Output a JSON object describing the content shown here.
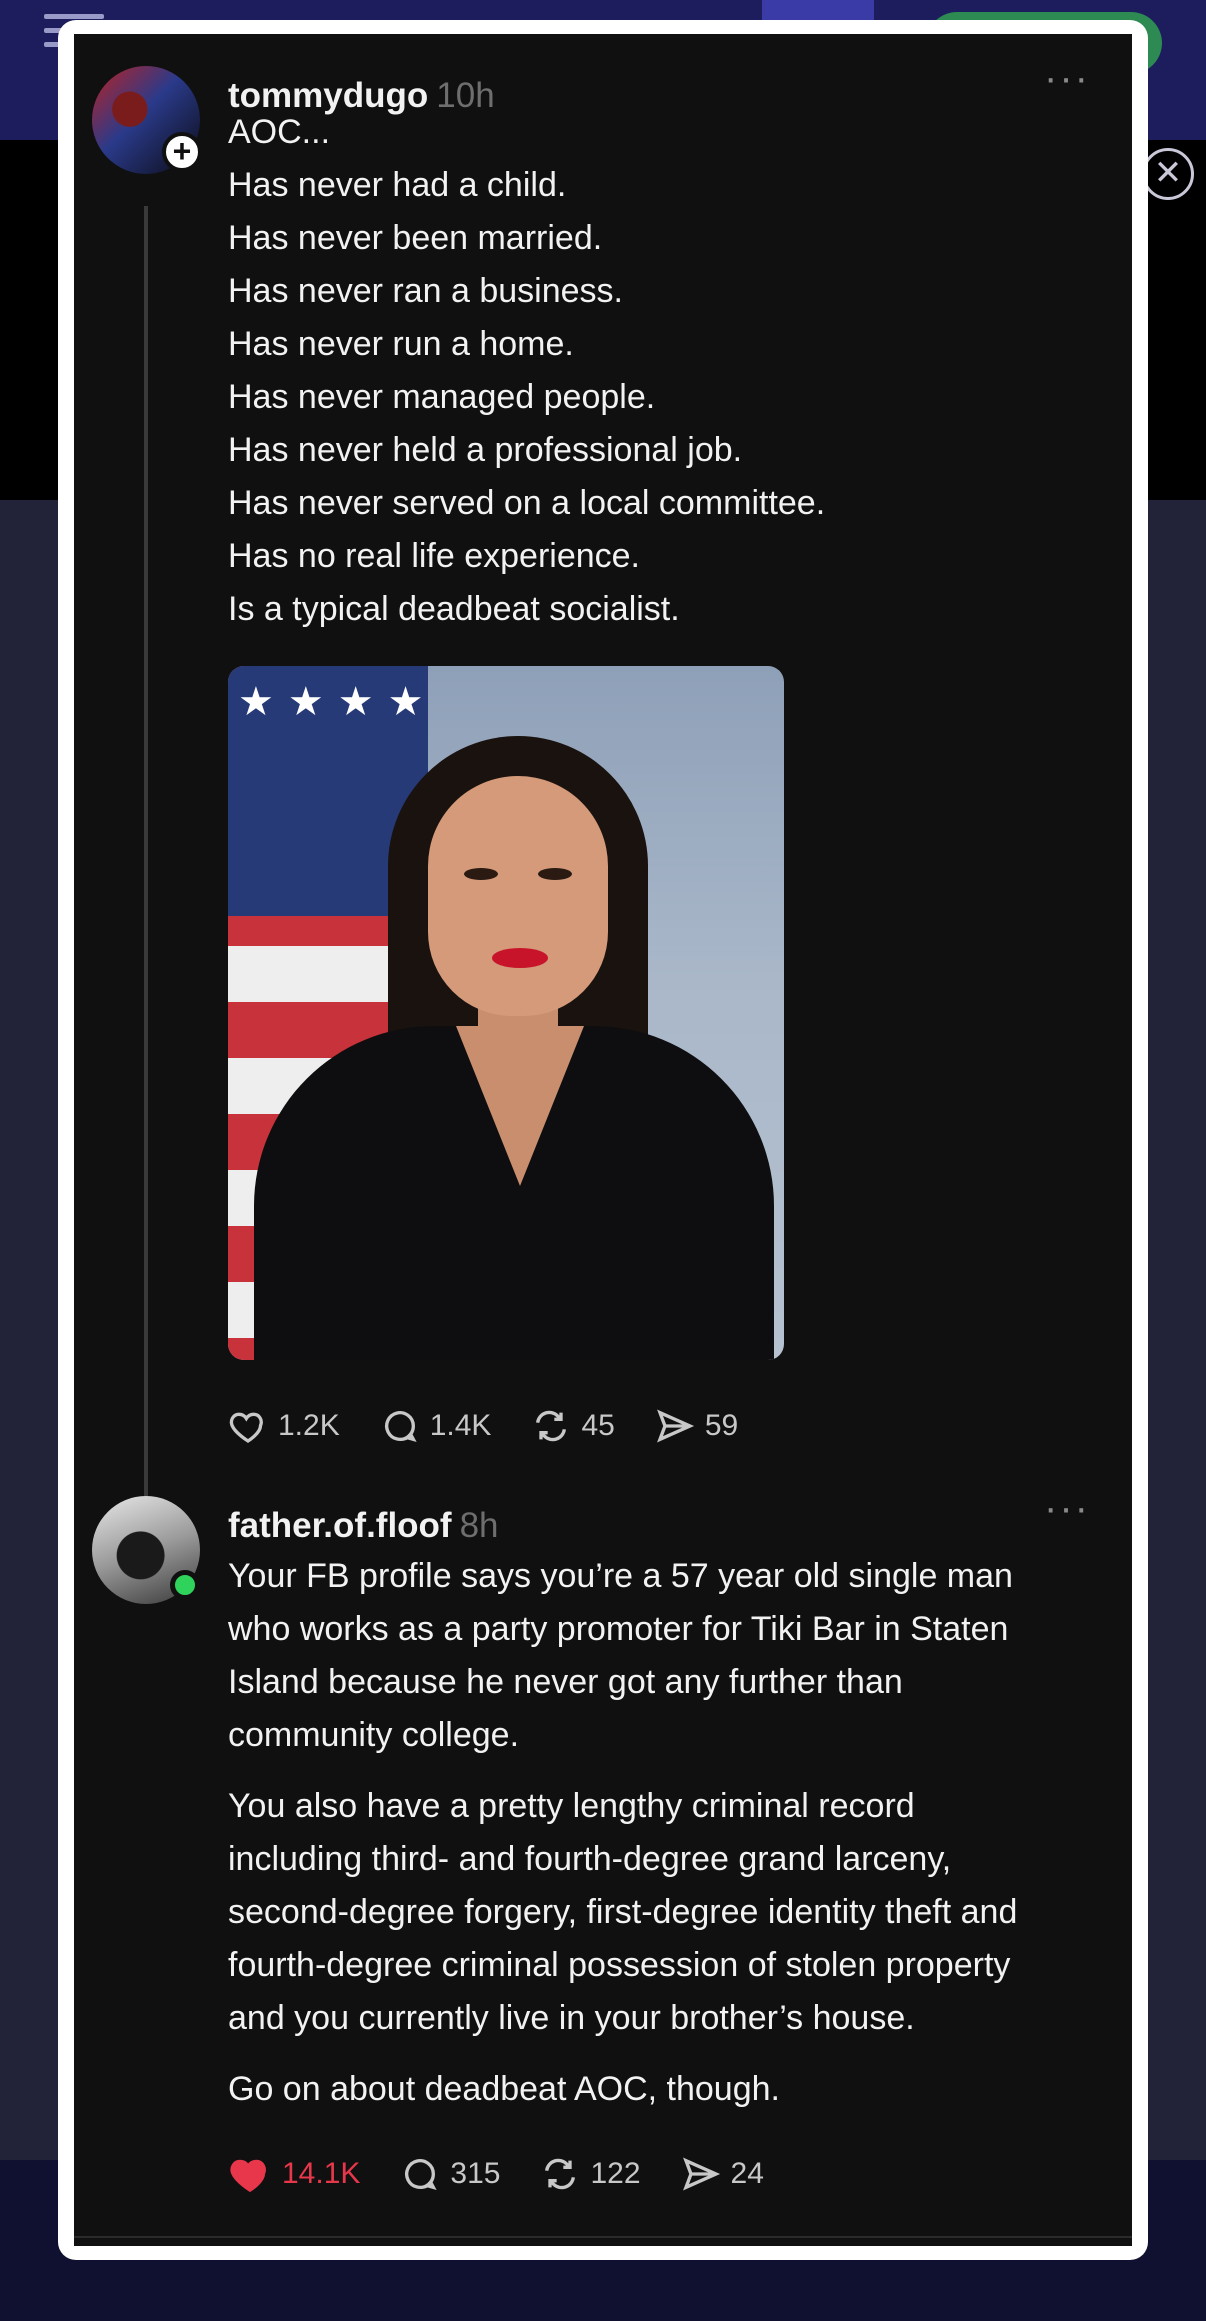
{
  "thread": {
    "original_post": {
      "username": "tommydugo",
      "time": "10h",
      "lines": [
        "AOC...",
        "Has never had a child.",
        "Has never been married.",
        "Has never ran a business.",
        "Has never run a home.",
        "Has never managed people.",
        "Has never held a professional job.",
        "Has never served on a local committee.",
        "Has no real life experience.",
        "Is a typical deadbeat socialist."
      ],
      "stats": {
        "likes": "1.2K",
        "replies": "1.4K",
        "reposts": "45",
        "shares": "59"
      }
    },
    "reply": {
      "username": "father.of.floof",
      "time": "8h",
      "paragraphs": [
        [
          "Your FB profile says you’re a 57 year old single man",
          "who works as a party promoter for Tiki Bar in Staten",
          "Island because he never got any further than",
          "community college."
        ],
        [
          "You also have a pretty lengthy criminal record",
          "including third- and fourth-degree grand larceny,",
          "second-degree forgery, first-degree identity theft and",
          "fourth-degree criminal possession of stolen property",
          "and you currently live in your brother’s house."
        ],
        [
          "Go on about deadbeat AOC, though."
        ]
      ],
      "stats": {
        "likes": "14.1K",
        "liked": true,
        "replies": "315",
        "reposts": "122",
        "shares": "24"
      }
    }
  },
  "colors": {
    "card_bg": "#101010",
    "text": "#f2f2f2",
    "muted": "#6e6e6e",
    "like_active": "#e8374b"
  },
  "icons": [
    "heart-icon",
    "comment-icon",
    "repost-icon",
    "share-icon",
    "more-icon",
    "plus-icon",
    "close-icon"
  ]
}
